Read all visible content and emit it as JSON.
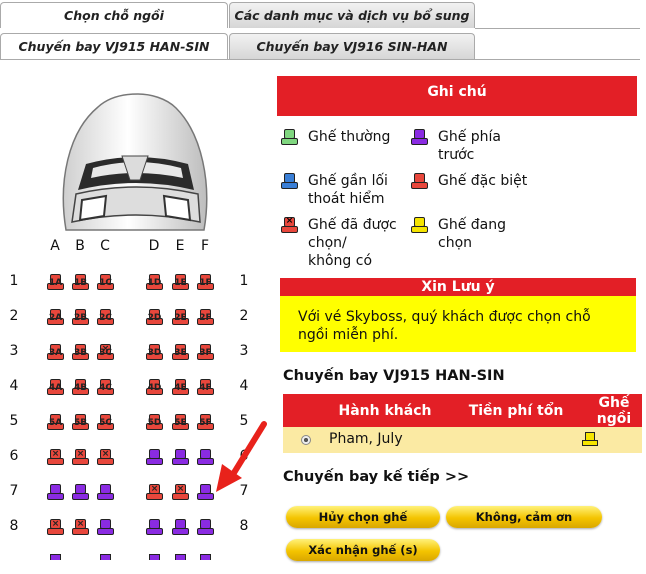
{
  "tabs": {
    "top": [
      "Chọn chỗ ngồi",
      "Các danh mục và dịch vụ bổ sung"
    ],
    "flights": [
      "Chuyến bay VJ915 HAN-SIN",
      "Chuyến bay VJ916 SIN-HAN"
    ]
  },
  "seat_map": {
    "columns": [
      "A",
      "B",
      "C",
      "D",
      "E",
      "F"
    ],
    "rows": [
      "1",
      "2",
      "3",
      "4",
      "5",
      "6",
      "7",
      "8"
    ],
    "seats": [
      [
        "1A",
        "1B",
        "1C",
        "1D",
        "1E",
        "1F"
      ],
      [
        "2A",
        "2B",
        "2C",
        "2D",
        "2E",
        "2F"
      ],
      [
        "3A",
        "3B",
        "3C",
        "3D",
        "3E",
        "3F"
      ],
      [
        "4A",
        "4B",
        "4C",
        "4D",
        "4E",
        "4F"
      ],
      [
        "5A",
        "5B",
        "5C",
        "5D",
        "5E",
        "5F"
      ],
      [
        "",
        "",
        "",
        "",
        "",
        ""
      ],
      [
        "",
        "",
        "",
        "",
        "",
        ""
      ],
      [
        "",
        "",
        "",
        "",
        "",
        ""
      ]
    ],
    "status": [
      [
        "special",
        "special",
        "special",
        "special",
        "special",
        "special"
      ],
      [
        "special",
        "special",
        "special",
        "special",
        "special",
        "special"
      ],
      [
        "special",
        "special",
        "unavailable",
        "special",
        "special",
        "special"
      ],
      [
        "special",
        "special",
        "special",
        "special",
        "special",
        "special"
      ],
      [
        "special",
        "special",
        "special",
        "special",
        "special",
        "special"
      ],
      [
        "unavailable",
        "unavailable",
        "unavailable",
        "front",
        "front",
        "front"
      ],
      [
        "front",
        "front",
        "front",
        "unavailable",
        "unavailable",
        "front"
      ],
      [
        "unavailable",
        "unavailable",
        "front",
        "front",
        "front",
        "front"
      ]
    ],
    "colors": {
      "special": "#e8473c",
      "unavailable": "#e8473c",
      "front": "#8a2be2"
    },
    "pointer_seat": "7F"
  },
  "legend": {
    "title": "Ghi chú",
    "items": [
      {
        "label1": "Ghế thường",
        "label2": "",
        "label3": "",
        "icon": "seat-regular-icon",
        "color": "#7fd67f"
      },
      {
        "label1": "Ghế phía",
        "label2": "trước",
        "label3": "",
        "icon": "seat-front-icon",
        "color": "#8a2be2"
      },
      {
        "label1": "Ghế gần lối",
        "label2": "thoát hiểm",
        "label3": "",
        "icon": "seat-exit-icon",
        "color": "#3a7fd6"
      },
      {
        "label1": "Ghế đặc biệt",
        "label2": "",
        "label3": "",
        "icon": "seat-special-icon",
        "color": "#e8473c"
      },
      {
        "label1": "Ghế đã được",
        "label2": "chọn/",
        "label3": "không có",
        "icon": "seat-unavailable-icon",
        "color": "#e8473c"
      },
      {
        "label1": "Ghế đang",
        "label2": "chọn",
        "label3": "",
        "icon": "seat-selecting-icon",
        "color": "#f5e400"
      }
    ]
  },
  "notice": {
    "title": "Xin Lưu ý",
    "line1": "Với vé Skyboss, quý khách được chọn chỗ",
    "line2": "ngồi miễn phí."
  },
  "flight": {
    "title": "Chuyến bay VJ915 HAN-SIN",
    "headers": {
      "passenger": "Hành khách",
      "fee": "Tiền phí tổn",
      "seat1": "Ghế",
      "seat2": "ngồi"
    },
    "passenger_name": "Pham, July",
    "next_flight": "Chuyến bay kế tiếp >>"
  },
  "buttons": {
    "cancel": "Hủy chọn ghế",
    "no_thanks": "Không, cảm ơn",
    "confirm": "Xác nhận ghế (s)"
  }
}
